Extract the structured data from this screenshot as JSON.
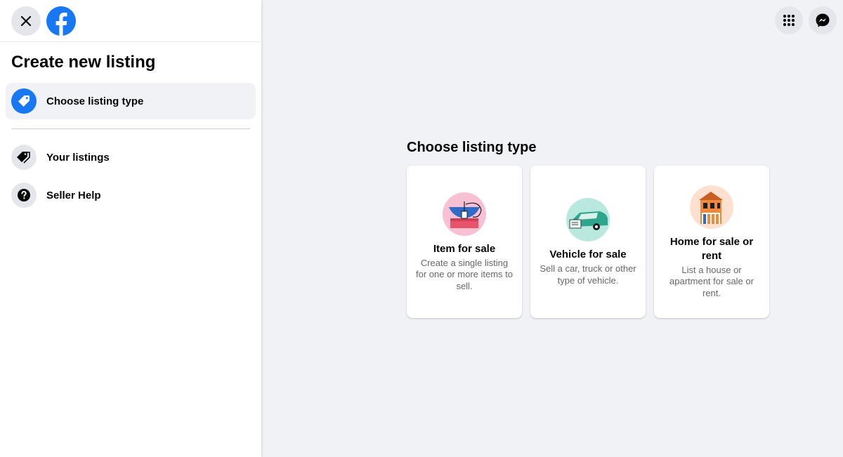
{
  "sidebar": {
    "title": "Create new listing",
    "items": [
      {
        "label": "Choose listing type",
        "icon": "tag-icon",
        "active": true
      },
      {
        "label": "Your listings",
        "icon": "tags-icon",
        "active": false
      },
      {
        "label": "Seller Help",
        "icon": "question-icon",
        "active": false
      }
    ]
  },
  "header": {
    "close_icon": "close-icon",
    "logo": "facebook-logo",
    "menu_icon": "grid-menu-icon",
    "messenger_icon": "messenger-icon"
  },
  "main": {
    "heading": "Choose listing type",
    "cards": [
      {
        "title": "Item for sale",
        "description": "Create a single listing for one or more items to sell.",
        "illustration": "item-illustration"
      },
      {
        "title": "Vehicle for sale",
        "description": "Sell a car, truck or other type of vehicle.",
        "illustration": "vehicle-illustration"
      },
      {
        "title": "Home for sale or rent",
        "description": "List a house or apartment for sale or rent.",
        "illustration": "home-illustration"
      }
    ]
  },
  "colors": {
    "brand": "#1877f2",
    "page_bg": "#f0f2f5",
    "secondary_text": "#65676b"
  }
}
